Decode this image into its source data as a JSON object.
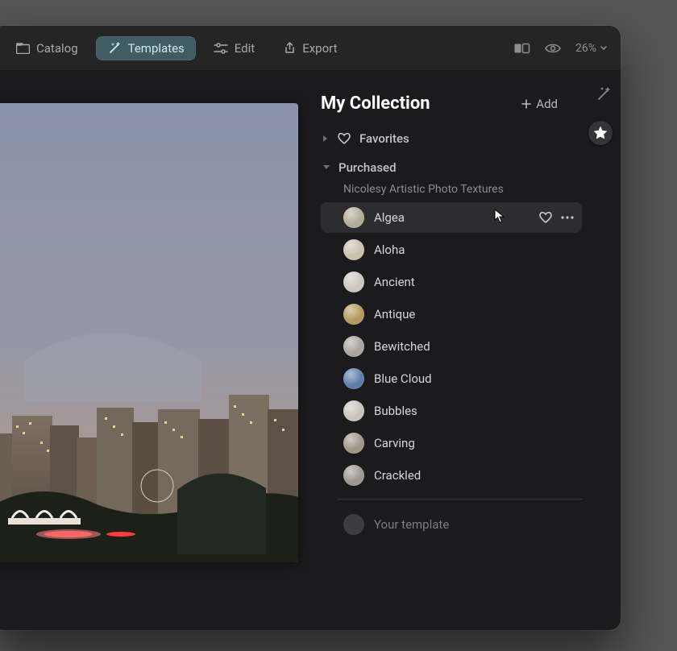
{
  "toolbar": {
    "catalog": "Catalog",
    "templates": "Templates",
    "edit": "Edit",
    "export": "Export",
    "zoom": "26%"
  },
  "panel": {
    "title": "My Collection",
    "add": "Add",
    "favorites": "Favorites",
    "purchased": "Purchased",
    "pack": "Nicolesy Artistic Photo Textures",
    "your_template": "Your template"
  },
  "templates": [
    {
      "name": "Algea",
      "swatch": "#b3ab9a",
      "hover": true
    },
    {
      "name": "Aloha",
      "swatch": "#c9c0ad"
    },
    {
      "name": "Ancient",
      "swatch": "#cdc6be"
    },
    {
      "name": "Antique",
      "swatch": "#b59a5f"
    },
    {
      "name": "Bewitched",
      "swatch": "#a9a4a0"
    },
    {
      "name": "Blue Cloud",
      "swatch": "#5e7ea8"
    },
    {
      "name": "Bubbles",
      "swatch": "#c9c4bb"
    },
    {
      "name": "Carving",
      "swatch": "#9f968a"
    },
    {
      "name": "Crackled",
      "swatch": "#9d9690"
    }
  ]
}
